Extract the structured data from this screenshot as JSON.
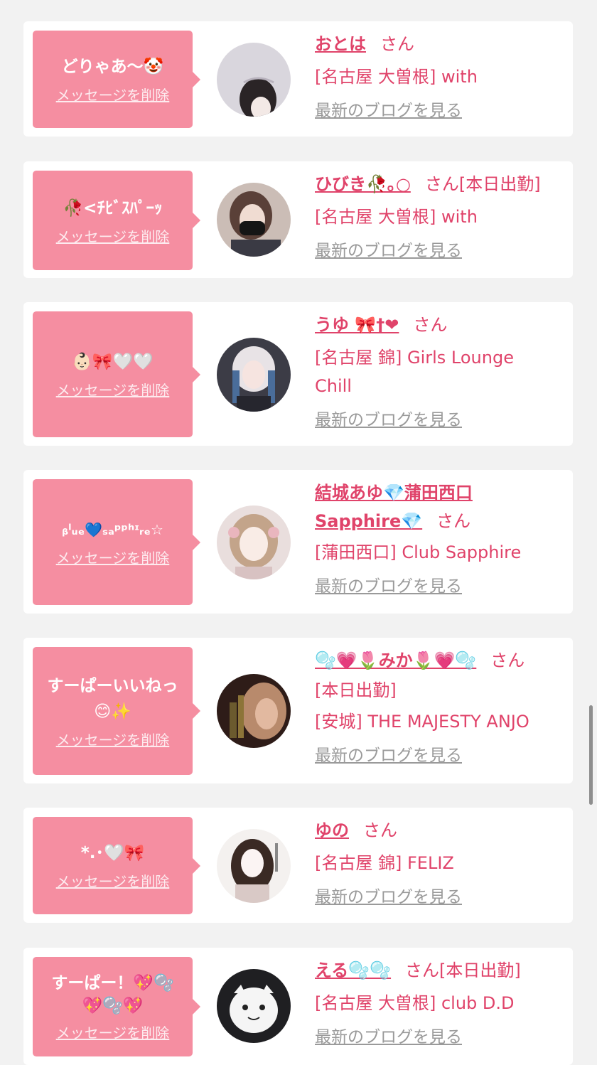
{
  "delete_label": "メッセージを削除",
  "blog_label": "最新のブログを見る",
  "san_label": "さん",
  "cards": [
    {
      "bubble_lines": [
        "どりゃあ〜🤡"
      ],
      "name": "おとは",
      "suffix": "",
      "shop_lines": [
        "[名古屋 大曽根] with"
      ]
    },
    {
      "bubble_lines": [
        "🥀<ﾁﾋﾞｽﾊﾟｰｯ"
      ],
      "name": "ひびき🥀｡○",
      "suffix": "[本日出勤]",
      "shop_lines": [
        "[名古屋 大曽根] with"
      ]
    },
    {
      "bubble_lines": [
        "👶🏻🎀🤍🤍"
      ],
      "name": "うゆ 🎀†❤",
      "suffix": "",
      "shop_lines": [
        "[名古屋 錦] Girls Lounge",
        "Chill"
      ]
    },
    {
      "bubble_lines": [
        "ᵦˡᵤₑ💙ₛₐᵖᵖʰᶦᵣₑ☆"
      ],
      "name": "結城あゆ💎蒲田西口 Sapphire💎",
      "suffix": "",
      "shop_lines": [
        "[蒲田西口] Club Sapphire"
      ]
    },
    {
      "bubble_lines": [
        "すーぱーいいねっ",
        "😊✨"
      ],
      "name": "🫧💗🌷みか🌷💗🫧",
      "suffix": "",
      "shop_lines": [
        "[本日出勤]",
        "[安城] THE MAJESTY ANJO"
      ]
    },
    {
      "bubble_lines": [
        "*.･🤍🎀"
      ],
      "name": "ゆの",
      "suffix": "",
      "shop_lines": [
        "[名古屋 錦] FELIZ"
      ]
    },
    {
      "bubble_lines": [
        "すーぱー！💖🫧",
        "💖🫧💖"
      ],
      "name": "える🫧🫧",
      "suffix": "[本日出勤]",
      "shop_lines": [
        "[名古屋 大曽根] club D.D"
      ]
    }
  ]
}
